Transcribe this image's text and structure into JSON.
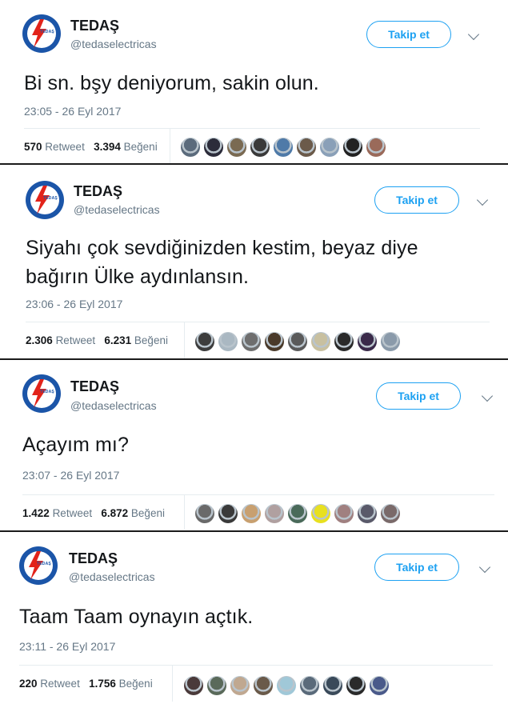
{
  "colors": {
    "accent": "#1da1f2",
    "brand_blue": "#1b55a8",
    "brand_red": "#e2231a",
    "muted": "#657786"
  },
  "tweets": [
    {
      "name": "TEDAŞ",
      "handle": "@tedaselectricas",
      "follow_label": "Takip et",
      "text": "Bi sn. bşy deniyorum, sakin olun.",
      "timestamp": "23:05 - 26 Eyl 2017",
      "retweet_count": "570",
      "retweet_label": "Retweet",
      "like_count": "3.394",
      "like_label": "Beğeni",
      "avatar_colors": [
        "#5b6b7c",
        "#2c2c3a",
        "#7a6a52",
        "#3a3a3a",
        "#4f7aa8",
        "#6b5a4a",
        "#8aa0b8",
        "#222222",
        "#9a6a5a"
      ]
    },
    {
      "name": "TEDAŞ",
      "handle": "@tedaselectricas",
      "follow_label": "Takip et",
      "text": "Siyahı çok sevdiğinizden kestim, beyaz diye bağırın Ülke aydınlansın.",
      "timestamp": "23:06 - 26 Eyl 2017",
      "retweet_count": "2.306",
      "retweet_label": "Retweet",
      "like_count": "6.231",
      "like_label": "Beğeni",
      "avatar_colors": [
        "#3d3d3d",
        "#aab8c2",
        "#6e6e6e",
        "#4a3a2a",
        "#5a5a5a",
        "#c8c0a0",
        "#2a2a2a",
        "#3a2a4a",
        "#8a9aaa"
      ]
    },
    {
      "name": "TEDAŞ",
      "handle": "@tedaselectricas",
      "follow_label": "Takip et",
      "text": "Açayım mı?",
      "timestamp": "23:07 - 26 Eyl 2017",
      "retweet_count": "1.422",
      "retweet_label": "Retweet",
      "like_count": "6.872",
      "like_label": "Beğeni",
      "avatar_colors": [
        "#6a6a6a",
        "#3a3a3a",
        "#c8a070",
        "#b0a0a0",
        "#4a6a5a",
        "#e8e020",
        "#a08080",
        "#5a5a6a",
        "#7a6a6a"
      ]
    },
    {
      "name": "TEDAŞ",
      "handle": "@tedaselectricas",
      "follow_label": "Takip et",
      "text": "Taam Taam oynayın açtık.",
      "timestamp": "23:11 - 26 Eyl 2017",
      "retweet_count": "220",
      "retweet_label": "Retweet",
      "like_count": "1.756",
      "like_label": "Beğeni",
      "avatar_colors": [
        "#4a3a3a",
        "#5a6a5a",
        "#c0a890",
        "#6a5a4a",
        "#a0c8d8",
        "#5a6a7a",
        "#3a4a5a",
        "#2a2a2a",
        "#4a5a8a"
      ]
    }
  ]
}
